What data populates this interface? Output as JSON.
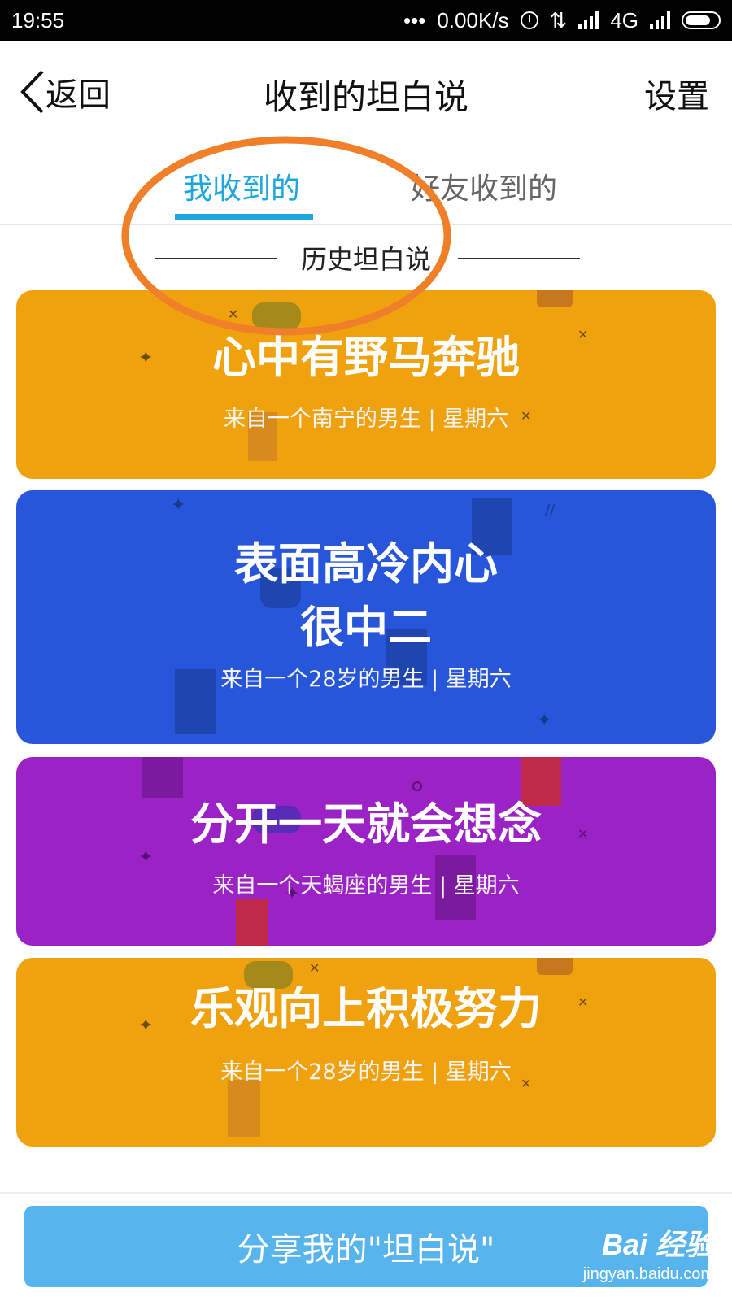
{
  "status_bar": {
    "time": "19:55",
    "dots": "•••",
    "speed": "0.00K/s",
    "updown": "⇅",
    "network": "4G"
  },
  "header": {
    "back_label": "返回",
    "title": "收到的坦白说",
    "settings_label": "设置"
  },
  "tabs": [
    {
      "label": "我收到的",
      "active": true
    },
    {
      "label": "好友收到的",
      "active": false
    }
  ],
  "section_title": "历史坦白说",
  "cards": [
    {
      "title": "心中有野马奔驰",
      "subtitle": "来自一个南宁的男生 | 星期六",
      "color": "#f0a20e"
    },
    {
      "title": "表面高冷内心\n很中二",
      "subtitle": "来自一个28岁的男生 | 星期六",
      "color": "#2756da"
    },
    {
      "title": "分开一天就会想念",
      "subtitle": "来自一个天蝎座的男生 | 星期六",
      "color": "#9b22c5"
    },
    {
      "title": "乐观向上积极努力",
      "subtitle": "来自一个28岁的男生 | 星期六",
      "color": "#f0a20e"
    }
  ],
  "share_button": {
    "label": "分享我的\"坦白说\""
  },
  "watermark": {
    "brand": "Bai 经验",
    "url": "jingyan.baidu.com"
  },
  "colors": {
    "accent": "#1da7dc",
    "annotation": "#f07f2a",
    "button": "#57b4ec"
  },
  "icons": {
    "back": "chevron-left-icon",
    "alarm": "alarm-icon",
    "signal": "signal-icon",
    "battery": "battery-icon"
  }
}
